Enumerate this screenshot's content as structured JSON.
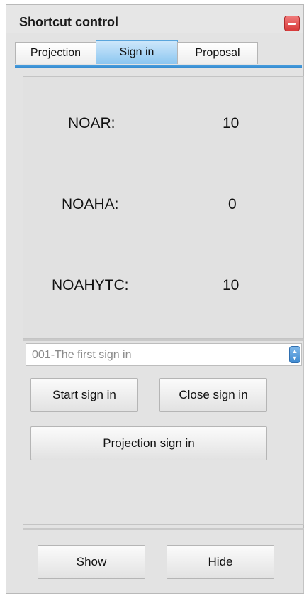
{
  "window": {
    "title": "Shortcut control",
    "close_icon": "minus-icon",
    "close_color": "#e04848"
  },
  "tabs": [
    {
      "label": "Projection",
      "active": false
    },
    {
      "label": "Sign in",
      "active": true
    },
    {
      "label": "Proposal",
      "active": false
    }
  ],
  "accent_color": "#3a92d8",
  "stats": [
    {
      "label": "NOAR:",
      "value": "10"
    },
    {
      "label": "NOAHA:",
      "value": "0"
    },
    {
      "label": "NOAHYTC:",
      "value": "10"
    }
  ],
  "sign_in_select": {
    "selected": "001-The first sign in",
    "icon": "updown-arrows-icon"
  },
  "buttons": {
    "start_sign_in": "Start sign in",
    "close_sign_in": "Close sign in",
    "projection_sign_in": "Projection sign in",
    "show": "Show",
    "hide": "Hide"
  }
}
